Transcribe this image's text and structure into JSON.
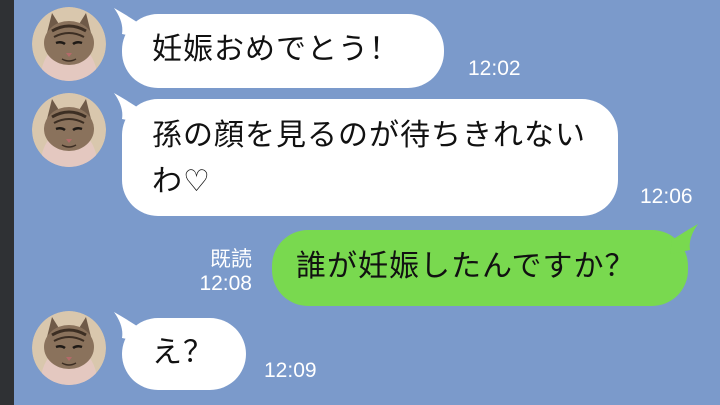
{
  "chat": {
    "colors": {
      "background": "#7b9acb",
      "incoming_bubble": "#ffffff",
      "outgoing_bubble": "#79d94f",
      "meta_text": "#ffffff"
    },
    "messages": [
      {
        "direction": "incoming",
        "avatar": "cat-avatar-icon",
        "text": "妊娠おめでとう！",
        "time": "12:02"
      },
      {
        "direction": "incoming",
        "avatar": "cat-avatar-icon",
        "text": "孫の顔を見るのが待ちきれないわ♡",
        "time": "12:06"
      },
      {
        "direction": "outgoing",
        "read": "既読",
        "text": "誰が妊娠したんですか？",
        "time": "12:08"
      },
      {
        "direction": "incoming",
        "avatar": "cat-avatar-icon",
        "text": "え？",
        "time": "12:09"
      }
    ]
  }
}
